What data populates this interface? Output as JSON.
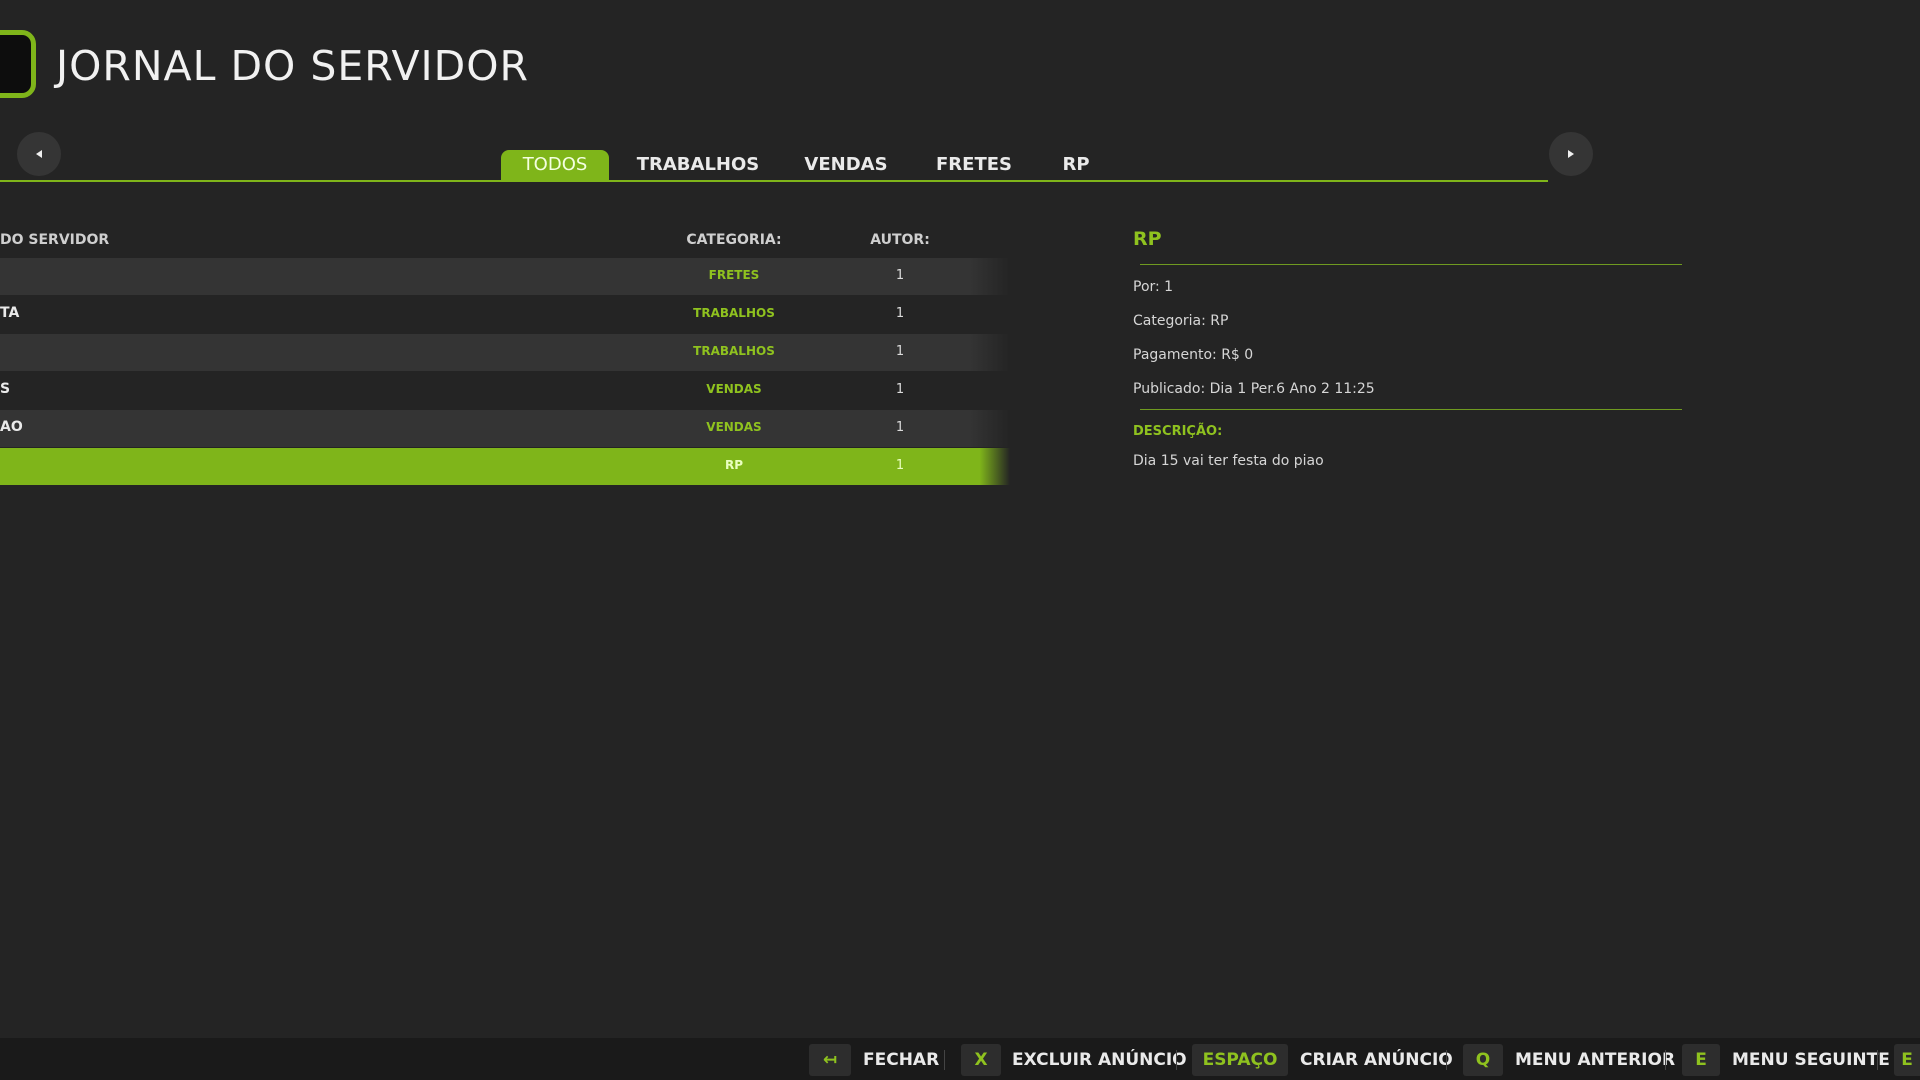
{
  "header": {
    "title": "JORNAL DO SERVIDOR"
  },
  "tabs": [
    {
      "label": "TODOS",
      "active": true
    },
    {
      "label": "TRABALHOS",
      "active": false
    },
    {
      "label": "VENDAS",
      "active": false
    },
    {
      "label": "FRETES",
      "active": false
    },
    {
      "label": "RP",
      "active": false
    }
  ],
  "table": {
    "headers": {
      "title": "DO SERVIDOR",
      "category": "CATEGORIA:",
      "author": "AUTOR:"
    },
    "rows": [
      {
        "title": "",
        "category": "FRETES",
        "author": "1"
      },
      {
        "title": "TA",
        "category": "TRABALHOS",
        "author": "1"
      },
      {
        "title": "",
        "category": "TRABALHOS",
        "author": "1"
      },
      {
        "title": "S",
        "category": "VENDAS",
        "author": "1"
      },
      {
        "title": "AO",
        "category": "VENDAS",
        "author": "1"
      },
      {
        "title": "",
        "category": "RP",
        "author": "1",
        "selected": true
      }
    ]
  },
  "detail": {
    "title": "RP",
    "por": "Por: 1",
    "categoria": "Categoria: RP",
    "pagamento": "Pagamento: R$ 0",
    "publicado": "Publicado: Dia 1 Per.6 Ano 2 11:25",
    "descricao_label": "DESCRIÇÃO:",
    "descricao": "Dia 15 vai ter festa do piao"
  },
  "footer": {
    "hints": [
      {
        "key": "↤",
        "label": "FECHAR"
      },
      {
        "key": "X",
        "label": "EXCLUIR ANÚNCIO"
      },
      {
        "key": "ESPAÇO",
        "label": "CRIAR ANÚNCIO"
      },
      {
        "key": "Q",
        "label": "MENU ANTERIOR"
      },
      {
        "key": "E",
        "label": "MENU SEGUINTE"
      },
      {
        "key": "E",
        "label": ""
      }
    ]
  },
  "colors": {
    "accent": "#7fb51a",
    "background": "#242424",
    "row_alt": "#343434",
    "bottom_bar": "#1a1a1a"
  },
  "icons": {
    "prev": "triangle-left-icon",
    "next": "triangle-right-icon",
    "logo": "logo-icon"
  }
}
